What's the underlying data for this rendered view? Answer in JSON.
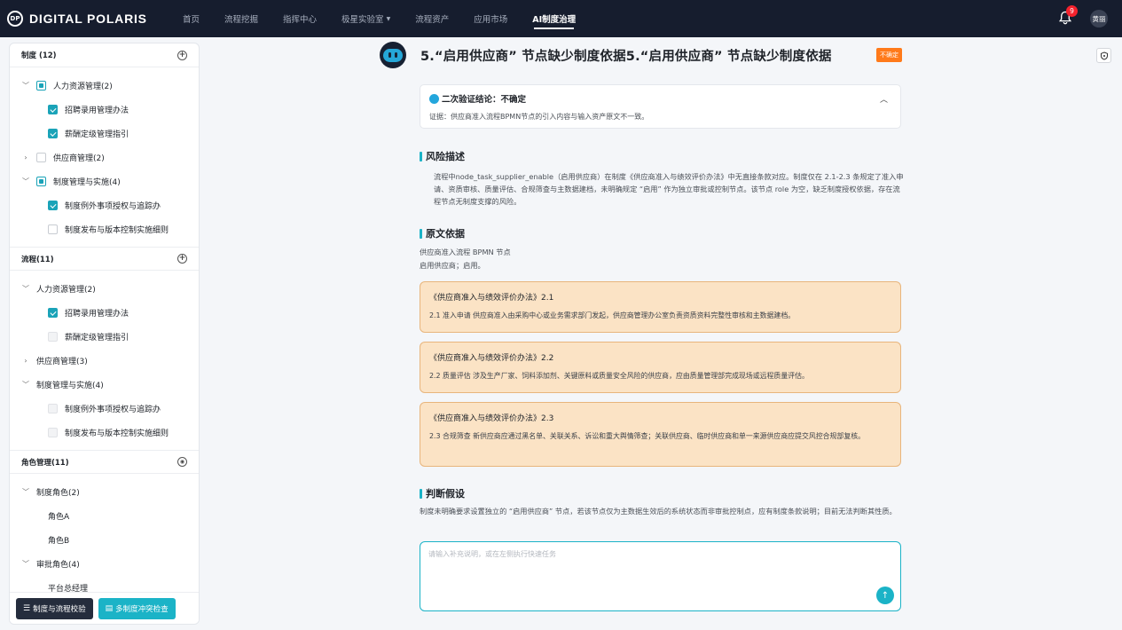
{
  "nav": {
    "logo_mark": "DP",
    "logo_text": "DIGITAL POLARIS",
    "items": [
      {
        "label": "首页"
      },
      {
        "label": "流程挖掘"
      },
      {
        "label": "指挥中心"
      },
      {
        "label": "极星实验室"
      },
      {
        "label": "流程资产"
      },
      {
        "label": "应用市场"
      },
      {
        "label": "AI制度治理"
      }
    ],
    "active_index": 6,
    "notification_count": "9",
    "avatar_text": "黄丽"
  },
  "sidebar": {
    "regulation": {
      "title": "制度 (12)",
      "rows": [
        {
          "label": "人力资源管理(2)"
        },
        {
          "label": "招聘录用管理办法"
        },
        {
          "label": "薪酬定级管理指引"
        },
        {
          "label": "供应商管理(2)"
        },
        {
          "label": "制度管理与实施(4)"
        },
        {
          "label": "制度例外事项授权与追踪办"
        },
        {
          "label": "制度发布与版本控制实施细则"
        }
      ]
    },
    "process": {
      "title": "流程(11)",
      "rows": [
        {
          "label": "人力资源管理(2)"
        },
        {
          "label": "招聘录用管理办法"
        },
        {
          "label": "薪酬定级管理指引"
        },
        {
          "label": "供应商管理(3)"
        },
        {
          "label": "制度管理与实施(4)"
        },
        {
          "label": "制度例外事项授权与追踪办"
        },
        {
          "label": "制度发布与版本控制实施细则"
        }
      ]
    },
    "roles": {
      "title": "角色管理(11)",
      "rows": [
        {
          "label": "制度角色(2)"
        },
        {
          "label": "角色A"
        },
        {
          "label": "角色B"
        },
        {
          "label": "审批角色(4)"
        },
        {
          "label": "平台总经理"
        }
      ]
    },
    "footer": {
      "check_label": "制度与流程校验",
      "conflict_label": "多制度冲突检查"
    }
  },
  "main": {
    "title": "5.“启用供应商” 节点缺少制度依据5.“启用供应商” 节点缺少制度依据",
    "status_tag": "不确定",
    "verification": {
      "title": "二次验证结论：不确定",
      "evidence": "证据：供应商准入流程BPMN节点的引入内容与输入资产原文不一致。"
    },
    "risk": {
      "heading": "风险描述",
      "text": "流程中node_task_supplier_enable（启用供应商）在制度《供应商准入与绩效评价办法》中无直接条款对应。制度仅在 2.1-2.3 条规定了准入申请、资质审核、质量评估、合规筛查与主数据建档，未明确规定 “启用” 作为独立审批或控制节点。该节点 role 为空，缺乏制度授权依据，存在流程节点无制度支撑的风险。"
    },
    "basis": {
      "heading": "原文依据",
      "line1": "供应商准入流程 BPMN 节点",
      "line2": "启用供应商；启用。",
      "quotes": [
        {
          "title": "《供应商准入与绩效评价办法》2.1",
          "text": "2.1 准入申请 供应商准入由采购中心或业务需求部门发起，供应商管理办公室负责资质资料完整性审核和主数据建档。"
        },
        {
          "title": "《供应商准入与绩效评价办法》2.2",
          "text": "2.2 质量评估 涉及生产厂家、饲料添加剂、关键原料或质量安全风险的供应商，应由质量管理部完成现场或远程质量评估。"
        },
        {
          "title": "《供应商准入与绩效评价办法》2.3",
          "text": "2.3 合规筛查 新供应商应通过黑名单、关联关系、诉讼和重大舆情筛查；关联供应商、临时供应商和单一来源供应商应提交风控合规部复核。"
        }
      ]
    },
    "judgement": {
      "heading": "判断假设",
      "text": "制度未明确要求设置独立的 “启用供应商” 节点，若该节点仅为主数据生效后的系统状态而非审批控制点，应有制度条款说明；目前无法判断其性质。"
    },
    "input": {
      "placeholder": "请输入补充说明，或在左侧执行快速任务"
    }
  },
  "colors": {
    "accent": "#1bb3c7",
    "topbar": "#161d2e",
    "quote_bg": "#fbe3c5",
    "quote_border": "#e8b57c",
    "tag": "#ff7a1a"
  }
}
